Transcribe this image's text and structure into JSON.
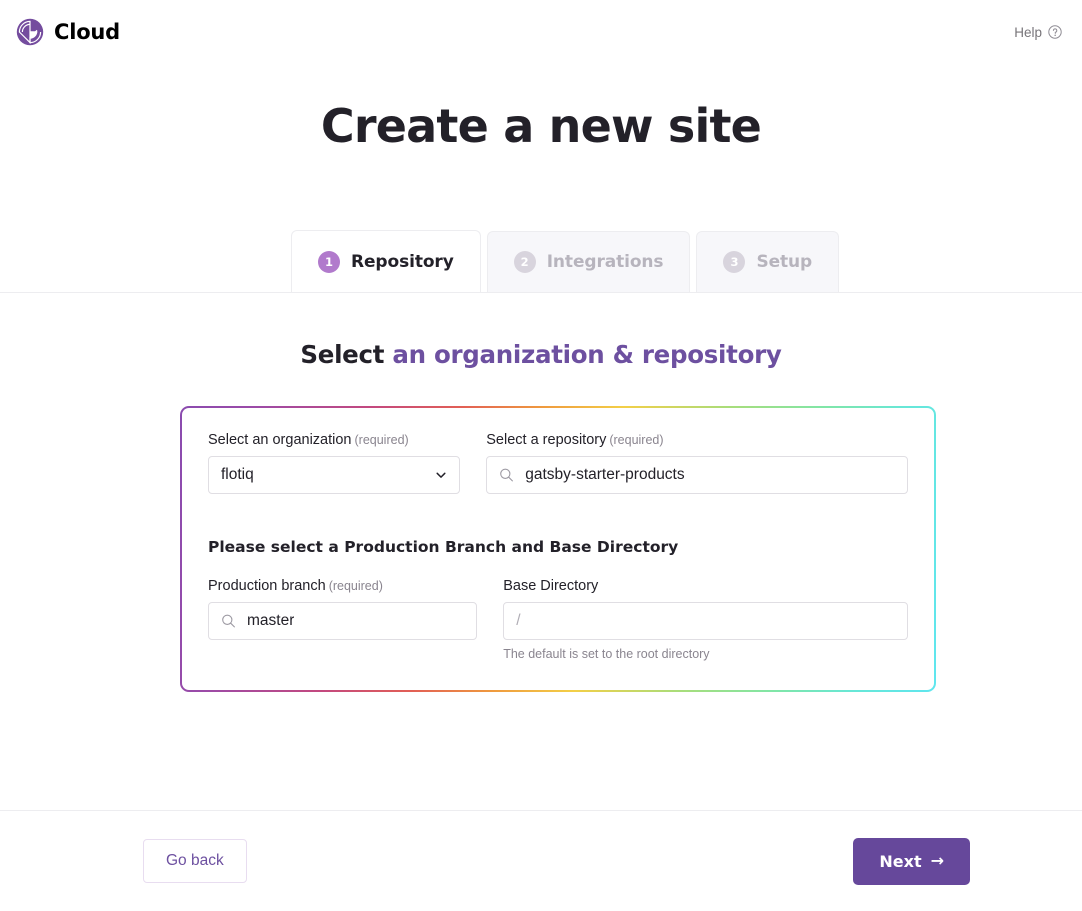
{
  "header": {
    "brand_name": "Cloud",
    "logo_icon": "gatsby-logo-icon",
    "help_label": "Help",
    "help_icon": "question-circle-icon"
  },
  "page_title": "Create a new site",
  "tabs": [
    {
      "number": "1",
      "label": "Repository",
      "active": true
    },
    {
      "number": "2",
      "label": "Integrations",
      "active": false
    },
    {
      "number": "3",
      "label": "Setup",
      "active": false
    }
  ],
  "section": {
    "heading_prefix": "Select ",
    "heading_accent": "an organization & repository"
  },
  "form": {
    "organization": {
      "label": "Select an organization",
      "required_note": "(required)",
      "value": "flotiq",
      "icon": "chevron-down-icon"
    },
    "repository": {
      "label": "Select a repository",
      "required_note": "(required)",
      "value": "gatsby-starter-products",
      "icon": "search-icon"
    },
    "subsection_title": "Please select a Production Branch and Base Directory",
    "production_branch": {
      "label": "Production branch",
      "required_note": "(required)",
      "value": "master",
      "icon": "search-icon"
    },
    "base_directory": {
      "label": "Base Directory",
      "required_note": "",
      "placeholder": "/",
      "value": "",
      "help_text": "The default is set to the root directory"
    }
  },
  "footer": {
    "back_label": "Go back",
    "next_label": "Next",
    "next_arrow": "→"
  },
  "colors": {
    "brand_purple": "#66489b",
    "accent_purple": "#6d50a0",
    "badge_active": "#b17acc",
    "badge_inactive": "#d8d4dd",
    "text_dark": "#232129",
    "text_muted": "#8a858f",
    "border": "#e0dee3"
  }
}
